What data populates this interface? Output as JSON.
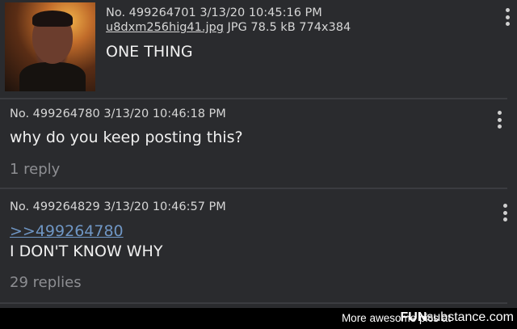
{
  "posts": [
    {
      "meta": "No. 499264701 3/13/20 10:45:16 PM",
      "file_name": "u8dxm256hig41.jpg",
      "file_info": "JPG 78.5 kB 774x384",
      "text": "ONE THING",
      "menu_icon": "more-vertical-icon"
    },
    {
      "meta": "No. 499264780 3/13/20 10:46:18 PM",
      "text": "why do you keep posting this?",
      "replies": "1 reply",
      "menu_icon": "more-vertical-icon"
    },
    {
      "meta": "No. 499264829 3/13/20 10:46:57 PM",
      "quote": ">>499264780",
      "text": "I DON'T KNOW WHY",
      "replies": "29 replies",
      "menu_icon": "more-vertical-icon"
    }
  ],
  "footer": {
    "tagline": "More awesome pics at",
    "brand_prefix": "FUN",
    "brand_suffix": "substance",
    "brand_tld": ".com"
  },
  "colors": {
    "background": "#2a2b2e",
    "quote_link": "#6f96c4",
    "reply_count": "#8d8e92"
  }
}
